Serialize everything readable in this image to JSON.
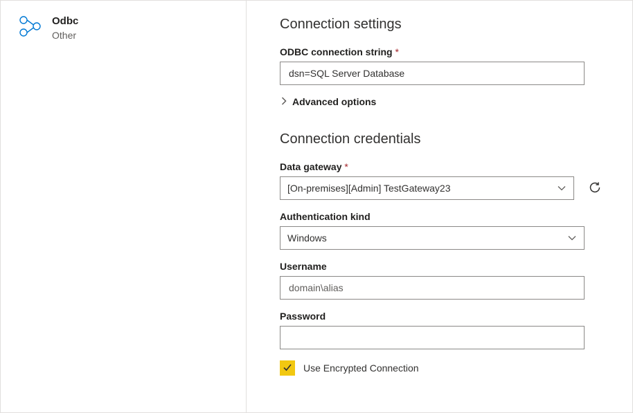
{
  "connector": {
    "title": "Odbc",
    "subtitle": "Other"
  },
  "settings": {
    "heading": "Connection settings",
    "connStr": {
      "label": "ODBC connection string",
      "required": "*",
      "value": "dsn=SQL Server Database"
    },
    "advanced": "Advanced options"
  },
  "credentials": {
    "heading": "Connection credentials",
    "gateway": {
      "label": "Data gateway",
      "required": "*",
      "value": "[On-premises][Admin] TestGateway23"
    },
    "authKind": {
      "label": "Authentication kind",
      "value": "Windows"
    },
    "username": {
      "label": "Username",
      "placeholder": "domain\\alias",
      "value": ""
    },
    "password": {
      "label": "Password",
      "value": ""
    },
    "encrypted": {
      "label": "Use Encrypted Connection",
      "checked": true
    }
  }
}
